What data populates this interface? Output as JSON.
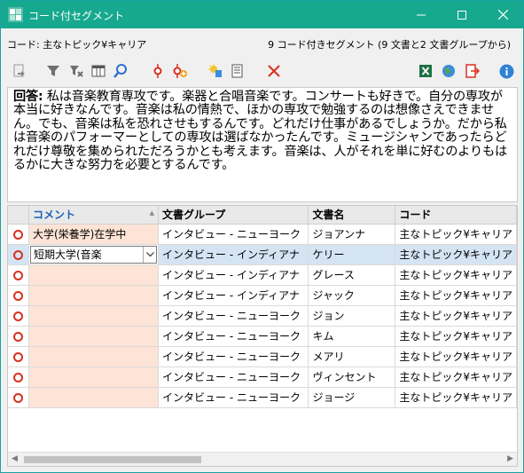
{
  "window": {
    "title": "コード付セグメント"
  },
  "info": {
    "code_label": "コード: 主なトピック¥キャリア",
    "summary": "9 コード付きセグメント (9 文書と2 文書グループから)"
  },
  "toolbar": {
    "icons": [
      "document-arrow-icon",
      "filter-icon",
      "clear-filter-icon",
      "columns-icon",
      "search-icon",
      "code-icon",
      "add-code-icon",
      "highlight-icon",
      "report-icon",
      "delete-icon",
      "excel-icon",
      "web-icon",
      "export-icon",
      "info-icon"
    ],
    "colors": {
      "delete": "#d9301f",
      "excel": "#1e7145",
      "info": "#2e82d6"
    }
  },
  "text_pane": {
    "label": "回答:",
    "text": "私は音楽教育専攻です。楽器と合唱音楽です。コンサートも好きで。自分の専攻が本当に好きなんです。音楽は私の情熱で、ほかの専攻で勉強するのは想像さえできません。でも、音楽は私を恐れさせもするんです。どれだけ仕事があるでしょうか。だから私は音楽のパフォーマーとしての専攻は選ばなかったんです。ミュージシャンであったらどれだけ尊敬を集められただろうかとも考えます。音楽は、人がそれを単に好むのよりもはるかに大きな努力を必要とするんです。"
  },
  "grid": {
    "columns": [
      "コメント",
      "文書グループ",
      "文書名",
      "コード"
    ],
    "rows": [
      {
        "comment": "大学(栄養学)在学中",
        "group": "インタビュー - ニューヨーク",
        "doc": "ジョアンナ",
        "code": "主なトピック¥キャリア"
      },
      {
        "comment": "短期大学(音楽",
        "group": "インタビュー - インディアナ",
        "doc": "ケリー",
        "code": "主なトピック¥キャリア"
      },
      {
        "comment": "",
        "group": "インタビュー - インディアナ",
        "doc": "グレース",
        "code": "主なトピック¥キャリア"
      },
      {
        "comment": "",
        "group": "インタビュー - インディアナ",
        "doc": "ジャック",
        "code": "主なトピック¥キャリア"
      },
      {
        "comment": "",
        "group": "インタビュー - ニューヨーク",
        "doc": "ジョン",
        "code": "主なトピック¥キャリア"
      },
      {
        "comment": "",
        "group": "インタビュー - ニューヨーク",
        "doc": "キム",
        "code": "主なトピック¥キャリア"
      },
      {
        "comment": "",
        "group": "インタビュー - ニューヨーク",
        "doc": "メアリ",
        "code": "主なトピック¥キャリア"
      },
      {
        "comment": "",
        "group": "インタビュー - ニューヨーク",
        "doc": "ヴィンセント",
        "code": "主なトピック¥キャリア"
      },
      {
        "comment": "",
        "group": "インタビュー - ニューヨーク",
        "doc": "ジョージ",
        "code": "主なトピック¥キャリア"
      }
    ],
    "selected_row": 1
  }
}
